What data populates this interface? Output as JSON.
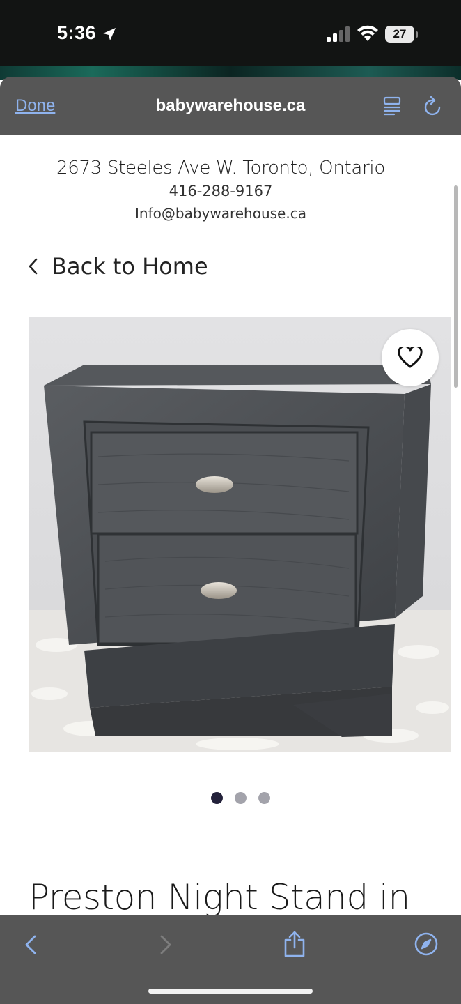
{
  "status_bar": {
    "time": "5:36",
    "battery": "27"
  },
  "browser": {
    "done_label": "Done",
    "url": "babywarehouse.ca"
  },
  "store_info": {
    "address": "2673 Steeles Ave W. Toronto, Ontario",
    "phone": "416-288-9167",
    "email": "Info@babywarehouse.ca"
  },
  "back_link": "Back to Home",
  "product": {
    "title": "Preston Night Stand in",
    "gallery_dots": 3,
    "active_dot": 0
  },
  "icons": {
    "location": "location-arrow-icon",
    "signal": "cellular-signal-icon",
    "wifi": "wifi-icon",
    "reader": "reader-mode-icon",
    "reload": "reload-icon",
    "back": "chevron-left-icon",
    "favorite": "heart-icon",
    "nav_back": "browser-back-icon",
    "nav_forward": "browser-forward-icon",
    "share": "share-icon",
    "safari": "compass-icon"
  }
}
